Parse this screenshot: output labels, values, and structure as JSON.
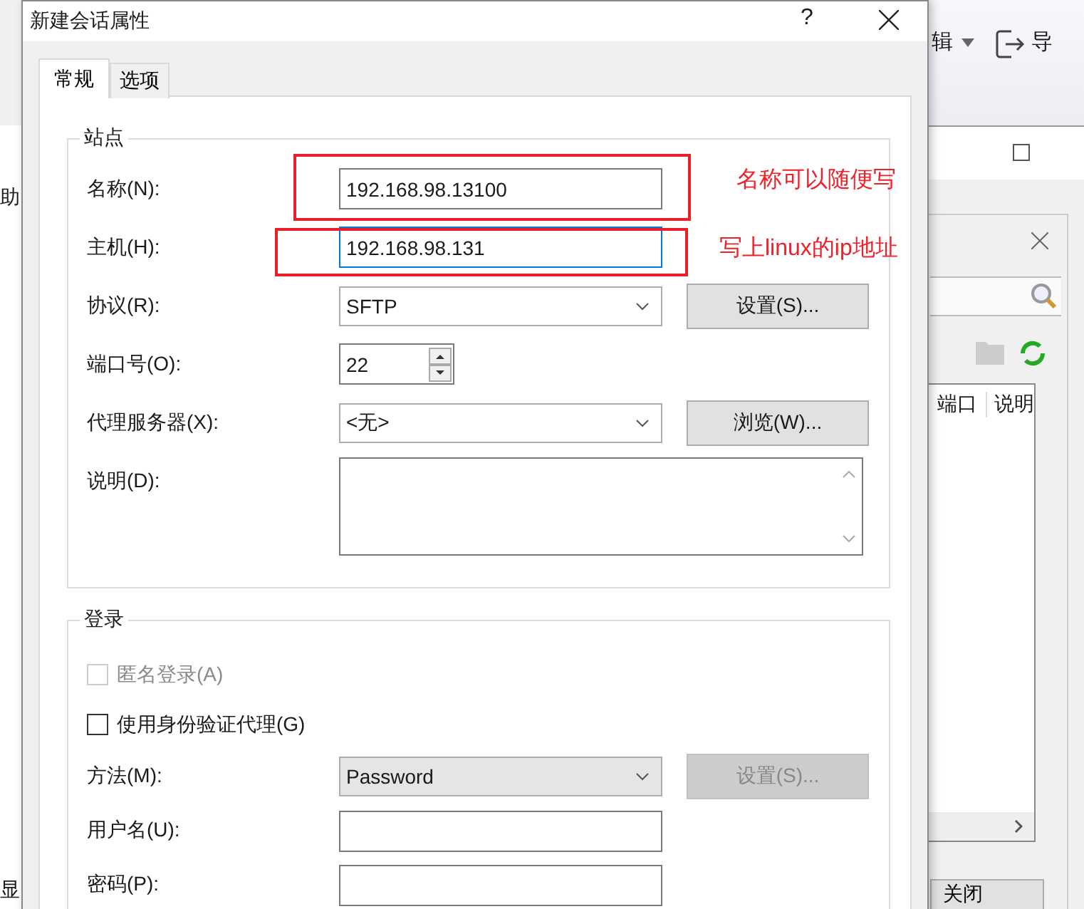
{
  "background": {
    "toolbar_items": [
      "辑",
      "导"
    ],
    "left_texts": [
      "助",
      "显"
    ],
    "panel": {
      "columns": [
        "端口",
        "说明"
      ],
      "close_button": "关闭"
    }
  },
  "dialog": {
    "title": "新建会话属性",
    "help": "?",
    "tabs": [
      {
        "label": "常规",
        "selected": true
      },
      {
        "label": "选项",
        "selected": false
      }
    ],
    "site": {
      "title": "站点",
      "fields": [
        {
          "kind": "text",
          "label": "名称(N):",
          "value": "192.168.98.13100",
          "focused": false
        },
        {
          "kind": "text",
          "label": "主机(H):",
          "value": "192.168.98.131",
          "focused": true
        },
        {
          "kind": "select",
          "label": "协议(R):",
          "value": "SFTP",
          "disabled": false,
          "button": {
            "label": "设置(S)...",
            "disabled": false
          }
        },
        {
          "kind": "spin",
          "label": "端口号(O):",
          "value": "22"
        },
        {
          "kind": "select",
          "label": "代理服务器(X):",
          "value": "<无>",
          "disabled": false,
          "button": {
            "label": "浏览(W)...",
            "disabled": false
          }
        },
        {
          "kind": "textarea",
          "label": "说明(D):"
        }
      ]
    },
    "login": {
      "title": "登录",
      "fields": [
        {
          "kind": "checkbox",
          "label": "匿名登录(A)",
          "checked": false,
          "disabled": true
        },
        {
          "kind": "checkbox",
          "label": "使用身份验证代理(G)",
          "checked": false,
          "disabled": false
        },
        {
          "kind": "select",
          "label": "方法(M):",
          "value": "Password",
          "disabled": true,
          "button": {
            "label": "设置(S)...",
            "disabled": true
          }
        },
        {
          "kind": "text",
          "label": "用户名(U):",
          "focused": false
        },
        {
          "kind": "text",
          "label": "密码(P):",
          "focused": false
        }
      ]
    }
  },
  "annotations": [
    {
      "text": "名称可以随便写"
    },
    {
      "text": "写上linux的ip地址"
    }
  ]
}
